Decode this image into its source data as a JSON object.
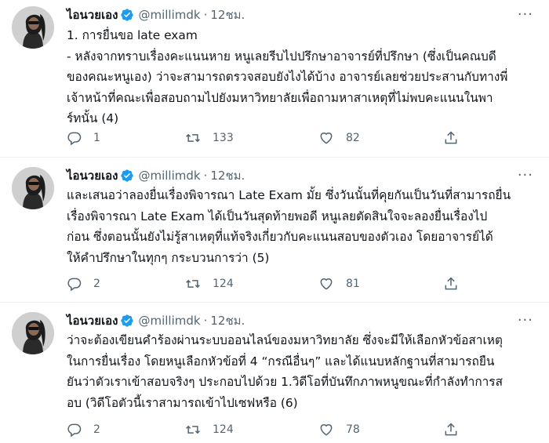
{
  "colors": {
    "text": "#0f1419",
    "secondary": "#536471",
    "verified": "#1d9bf0",
    "divider": "#eff3f4"
  },
  "tweets": [
    {
      "name": "ไอนวยเอง",
      "handle": "@millimdk",
      "dot": "·",
      "time": "12ชม.",
      "more": "···",
      "lines": [
        "1. การยื่นขอ late exam",
        "- หลังจากทราบเรื่องคะแนนหาย หนูเลยรีบไปปรึกษาอาจารย์ที่ปรึกษา (ซึ่งเป็นคณบดี",
        "ของคณะหนูเอง) ว่าจะสามารถตรวจสอบยังไงได้บ้าง อาจารย์เลยช่วยประสานกับทางพี่",
        "เจ้าหน้าที่คณะเพื่อสอบถามไปยังมหาวิทยาลัยเพื่อถามหาสาเหตุที่ไม่พบคะแนนในพา",
        "ร์ทนั้น (4)"
      ],
      "replies": "1",
      "retweets": "133",
      "likes": "82",
      "icons": [
        "reply-icon",
        "retweet-icon",
        "like-icon",
        "share-icon"
      ]
    },
    {
      "name": "ไอนวยเอง",
      "handle": "@millimdk",
      "dot": "·",
      "time": "12ชม.",
      "more": "···",
      "lines": [
        "และเสนอว่าลองยื่นเรื่องพิจารณา Late Exam มั้ย ซึ่งวันนั้นที่คุยกันเป็นวันที่สามารถยื่น",
        "เรื่องพิจารณา Late Exam ได้เป็นวันสุดท้ายพอดี หนูเลยตัดสินใจจะลองยื่นเรื่องไป",
        "ก่อน ซึ่งตอนนั้นยังไม่รู้สาเหตุที่แท้จริงเกี่ยวกับคะแนนสอบของตัวเอง โดยอาจารย์ได้",
        "ให้คำปรึกษาในทุกๆ กระบวนการว่า (5)"
      ],
      "replies": "2",
      "retweets": "124",
      "likes": "81",
      "icons": [
        "reply-icon",
        "retweet-icon",
        "like-icon",
        "share-icon"
      ]
    },
    {
      "name": "ไอนวยเอง",
      "handle": "@millimdk",
      "dot": "·",
      "time": "12ชม.",
      "more": "···",
      "lines": [
        "ว่าจะต้องเขียนคำร้องผ่านระบบออนไลน์ของมหาวิทยาลัย ซึ่งจะมีให้เลือกหัวข้อสาเหตุ",
        "ในการยื่นเรื่อง โดยหนูเลือกหัวข้อที่ 4 “กรณีอื่นๆ” และได้แนบหลักฐานที่สามารถยืน",
        "ยันว่าตัวเราเข้าสอบจริงๆ ประกอบไปด้วย 1.วิดีโอที่บันทึกภาพหนูขณะที่กำลังทำการส",
        "อบ (วิดีโอตัวนี้เราสามารถเข้าไปเซฟหรือ (6)"
      ],
      "replies": "2",
      "retweets": "124",
      "likes": "78",
      "icons": [
        "reply-icon",
        "retweet-icon",
        "like-icon",
        "share-icon"
      ]
    }
  ]
}
